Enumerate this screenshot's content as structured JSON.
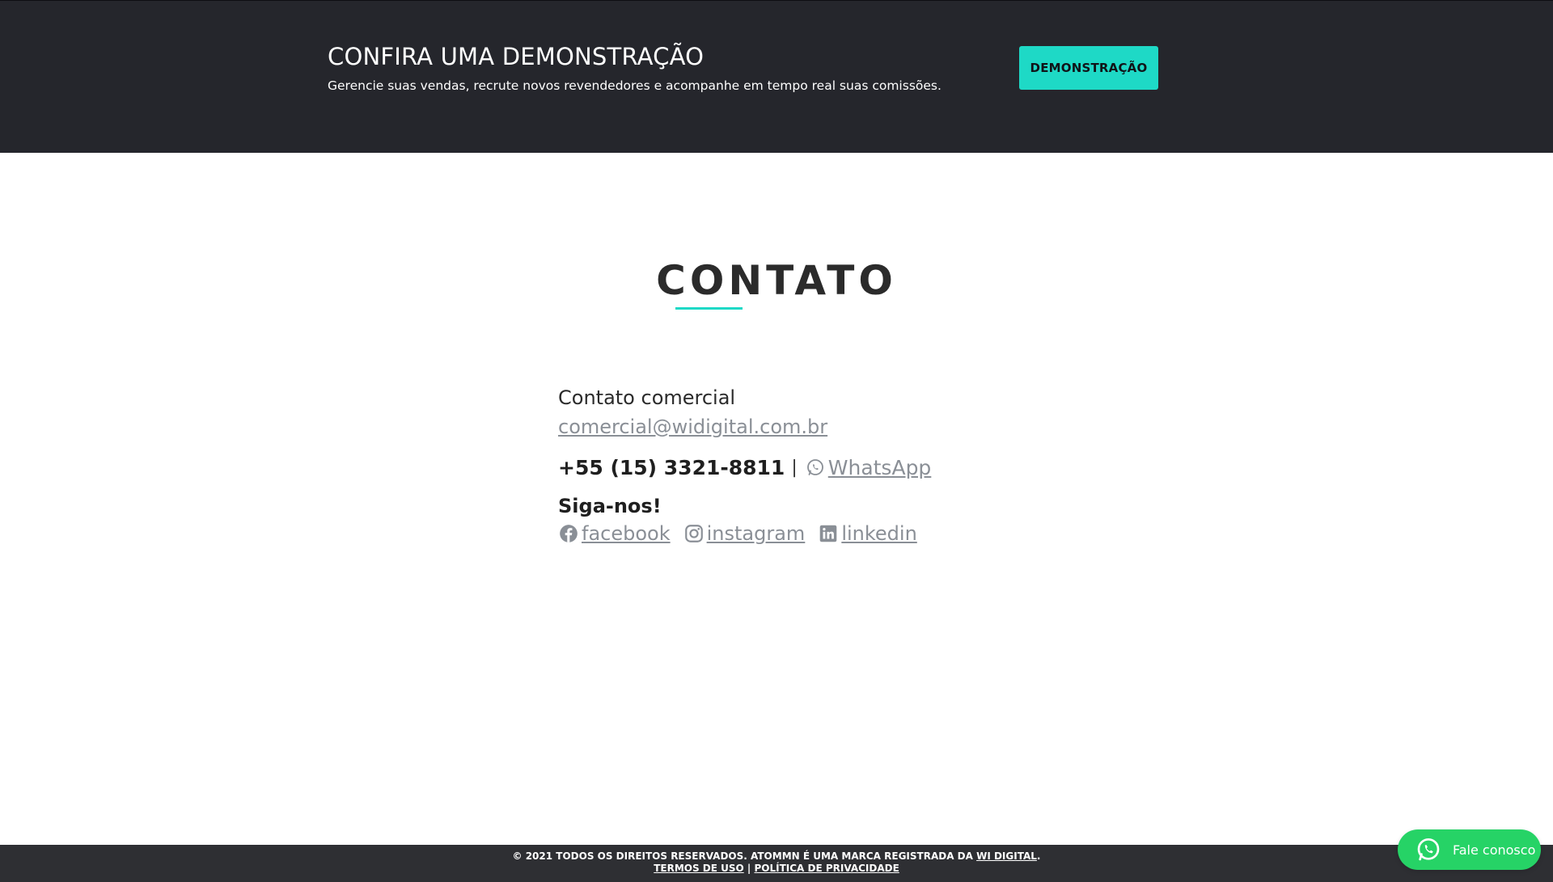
{
  "banner": {
    "title": "CONFIRA UMA DEMONSTRAÇÃO",
    "subtitle": "Gerencie suas vendas, recrute novos revendedores e acompanhe em tempo real suas comissões.",
    "button_label": "DEMONSTRAÇÃO",
    "background_color": "#25262c",
    "accent_color": "#1ed9c6"
  },
  "contact": {
    "title": "CONTATO",
    "commercial_label": "Contato comercial",
    "email": "comercial@widigital.com.br",
    "phone": "+55 (15) 3321-8811",
    "separator": "|",
    "whatsapp_label": " WhatsApp",
    "whatsapp_icon": "whatsapp-icon",
    "follow_label": "Siga-nos!",
    "social": [
      {
        "label": "facebook",
        "icon": "facebook-icon"
      },
      {
        "label": "instagram",
        "icon": "instagram-icon"
      },
      {
        "label": "linkedin",
        "icon": "linkedin-icon"
      }
    ]
  },
  "footer": {
    "copyright": "© 2021 TODOS OS DIREITOS RESERVADOS. ATOMMN É UMA MARCA REGISTRADA DA",
    "brand_link": "WI DIGITAL",
    "period": ".",
    "terms": "TERMOS DE USO",
    "separator": "|",
    "privacy": "POLÍTICA DE PRIVACIDADE",
    "background_color": "#2e2f33"
  },
  "chat": {
    "label": "Fale conosco",
    "icon": "whatsapp-icon",
    "color": "#26d366"
  }
}
